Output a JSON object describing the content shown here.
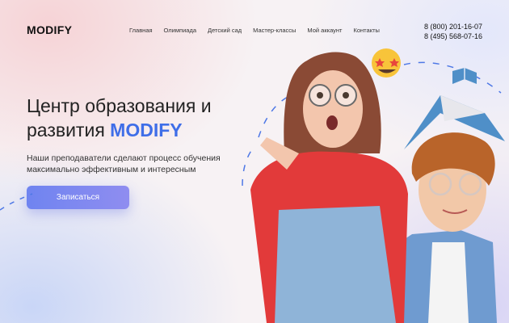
{
  "header": {
    "logo": "MODIFY",
    "nav": [
      "Главная",
      "Олимпиада",
      "Детский сад",
      "Мастер-классы",
      "Мой аккаунт",
      "Контакты"
    ],
    "phones": [
      "8 (800) 201-16-07",
      "8 (495) 568-07-16"
    ]
  },
  "hero": {
    "title_line1": "Центр образования и",
    "title_line2_prefix": "развития ",
    "title_brand": "MODIFY",
    "subtitle_line1": "Наши преподаватели сделают процесс обучения",
    "subtitle_line2": "максимально эффективным и интересным",
    "cta_label": "Записаться"
  },
  "colors": {
    "accent": "#3f6ee8",
    "button": "#7a86f0",
    "girl_shirt": "#e23a3a",
    "overalls": "#8fb4d8"
  },
  "icons": [
    "star-struck-emoji-icon",
    "book-icon"
  ]
}
